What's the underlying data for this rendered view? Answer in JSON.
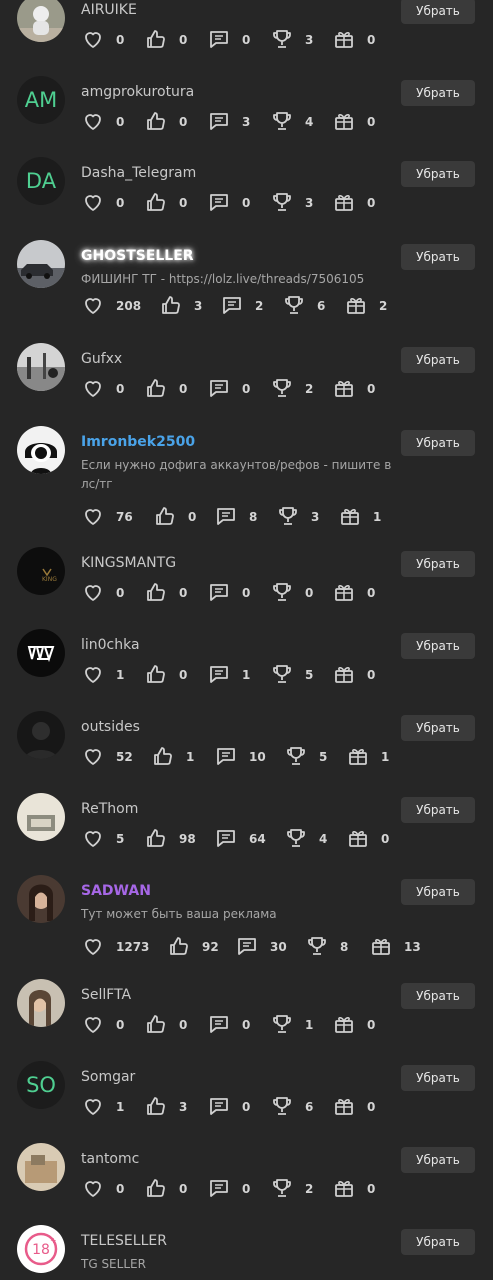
{
  "colors": {
    "background": "#262626",
    "button": "#3a3a3a",
    "name_blue": "#4aa3e8",
    "name_purple": "#a667e6",
    "letters_green": "#4fcf91"
  },
  "remove_label": "Убрать",
  "users": [
    {
      "name": "AIRUIKE",
      "stats": [
        "0",
        "0",
        "0",
        "3",
        "0"
      ]
    },
    {
      "name": "amgprokurotura",
      "avatar_text": "AM",
      "stats": [
        "0",
        "0",
        "3",
        "4",
        "0"
      ]
    },
    {
      "name": "Dasha_Telegram",
      "avatar_text": "DA",
      "stats": [
        "0",
        "0",
        "0",
        "3",
        "0"
      ]
    },
    {
      "name": "GHOSTSELLER",
      "status": "ФИШИНГ ТГ - https://lolz.live/threads/7506105",
      "stats": [
        "208",
        "3",
        "2",
        "6",
        "2"
      ]
    },
    {
      "name": "Gufxx",
      "stats": [
        "0",
        "0",
        "0",
        "2",
        "0"
      ]
    },
    {
      "name": "Imronbek2500",
      "status": "Если нужно дофига аккаунтов/рефов - пишите в лс/тг",
      "stats": [
        "76",
        "0",
        "8",
        "3",
        "1"
      ]
    },
    {
      "name": "KINGSMANTG",
      "stats": [
        "0",
        "0",
        "0",
        "0",
        "0"
      ]
    },
    {
      "name": "lin0chka",
      "stats": [
        "1",
        "0",
        "1",
        "5",
        "0"
      ]
    },
    {
      "name": "outsides",
      "stats": [
        "52",
        "1",
        "10",
        "5",
        "1"
      ]
    },
    {
      "name": "ReThom",
      "stats": [
        "5",
        "98",
        "64",
        "4",
        "0"
      ]
    },
    {
      "name": "SADWAN",
      "status": "Тут может быть ваша реклама",
      "stats": [
        "1273",
        "92",
        "30",
        "8",
        "13"
      ]
    },
    {
      "name": "SellFTA",
      "stats": [
        "0",
        "0",
        "0",
        "1",
        "0"
      ]
    },
    {
      "name": "Somgar",
      "avatar_text": "SO",
      "stats": [
        "1",
        "3",
        "0",
        "6",
        "0"
      ]
    },
    {
      "name": "tantomc",
      "stats": [
        "0",
        "0",
        "0",
        "2",
        "0"
      ]
    },
    {
      "name": "TELESELLER",
      "status": "TG SELLER",
      "avatar_text": "18"
    }
  ]
}
